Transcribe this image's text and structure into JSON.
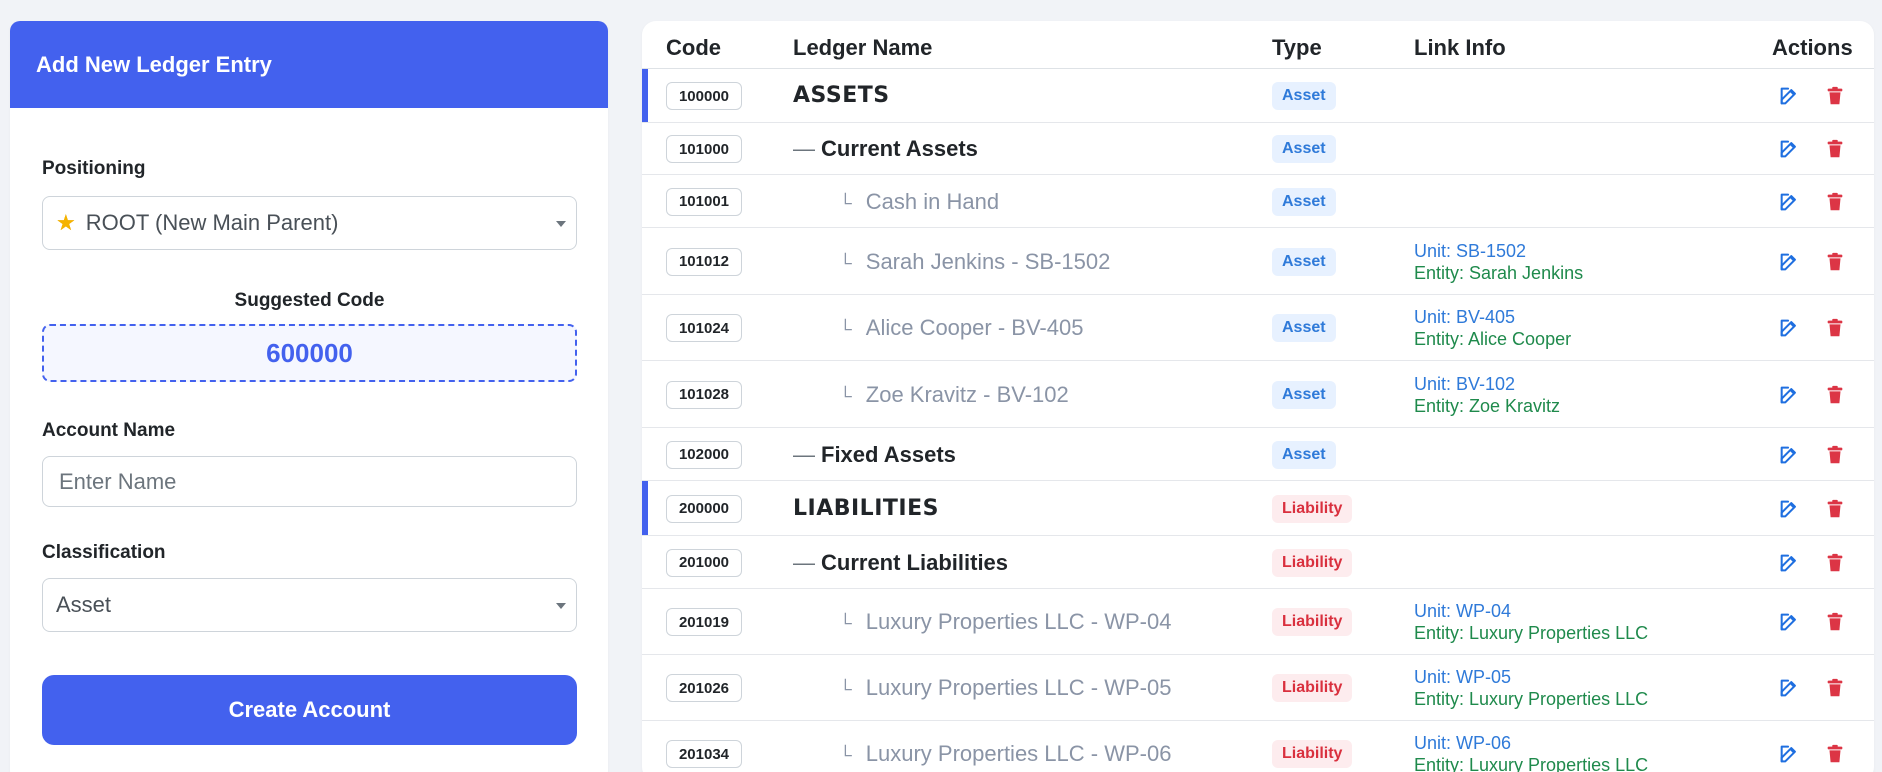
{
  "form": {
    "title": "Add New Ledger Entry",
    "positioning_label": "Positioning",
    "positioning_value": "ROOT (New Main Parent)",
    "suggested_label": "Suggested Code",
    "suggested_code": "600000",
    "account_name_label": "Account Name",
    "account_name_placeholder": "Enter Name",
    "classification_label": "Classification",
    "classification_value": "Asset",
    "create_button": "Create Account"
  },
  "table": {
    "headers": {
      "code": "Code",
      "name": "Ledger Name",
      "type": "Type",
      "link": "Link Info",
      "actions": "Actions"
    },
    "rows": [
      {
        "code": "100000",
        "name": "ASSETS",
        "level": 0,
        "type": "Asset",
        "unit": "",
        "entity": ""
      },
      {
        "code": "101000",
        "name": "Current Assets",
        "level": 1,
        "type": "Asset",
        "unit": "",
        "entity": ""
      },
      {
        "code": "101001",
        "name": "Cash in Hand",
        "level": 2,
        "type": "Asset",
        "unit": "",
        "entity": ""
      },
      {
        "code": "101012",
        "name": "Sarah Jenkins - SB-1502",
        "level": 2,
        "type": "Asset",
        "unit": "Unit: SB-1502",
        "entity": "Entity: Sarah Jenkins"
      },
      {
        "code": "101024",
        "name": "Alice Cooper - BV-405",
        "level": 2,
        "type": "Asset",
        "unit": "Unit: BV-405",
        "entity": "Entity: Alice Cooper"
      },
      {
        "code": "101028",
        "name": "Zoe Kravitz - BV-102",
        "level": 2,
        "type": "Asset",
        "unit": "Unit: BV-102",
        "entity": "Entity: Zoe Kravitz"
      },
      {
        "code": "102000",
        "name": "Fixed Assets",
        "level": 1,
        "type": "Asset",
        "unit": "",
        "entity": ""
      },
      {
        "code": "200000",
        "name": "LIABILITIES",
        "level": 0,
        "type": "Liability",
        "unit": "",
        "entity": ""
      },
      {
        "code": "201000",
        "name": "Current Liabilities",
        "level": 1,
        "type": "Liability",
        "unit": "",
        "entity": ""
      },
      {
        "code": "201019",
        "name": "Luxury Properties LLC - WP-04",
        "level": 2,
        "type": "Liability",
        "unit": "Unit: WP-04",
        "entity": "Entity: Luxury Properties LLC"
      },
      {
        "code": "201026",
        "name": "Luxury Properties LLC - WP-05",
        "level": 2,
        "type": "Liability",
        "unit": "Unit: WP-05",
        "entity": "Entity: Luxury Properties LLC"
      },
      {
        "code": "201034",
        "name": "Luxury Properties LLC - WP-06",
        "level": 2,
        "type": "Liability",
        "unit": "Unit: WP-06",
        "entity": "Entity: Luxury Properties LLC"
      }
    ]
  },
  "colors": {
    "accent": "#4361ee",
    "asset": "#2f7ad9",
    "liability": "#d9303e",
    "entity": "#1f8a4c",
    "edit": "#1f6fe0",
    "delete": "#dc3545"
  },
  "icons": {
    "positioning": "star-icon",
    "edit": "edit-icon",
    "delete": "trash-icon"
  }
}
